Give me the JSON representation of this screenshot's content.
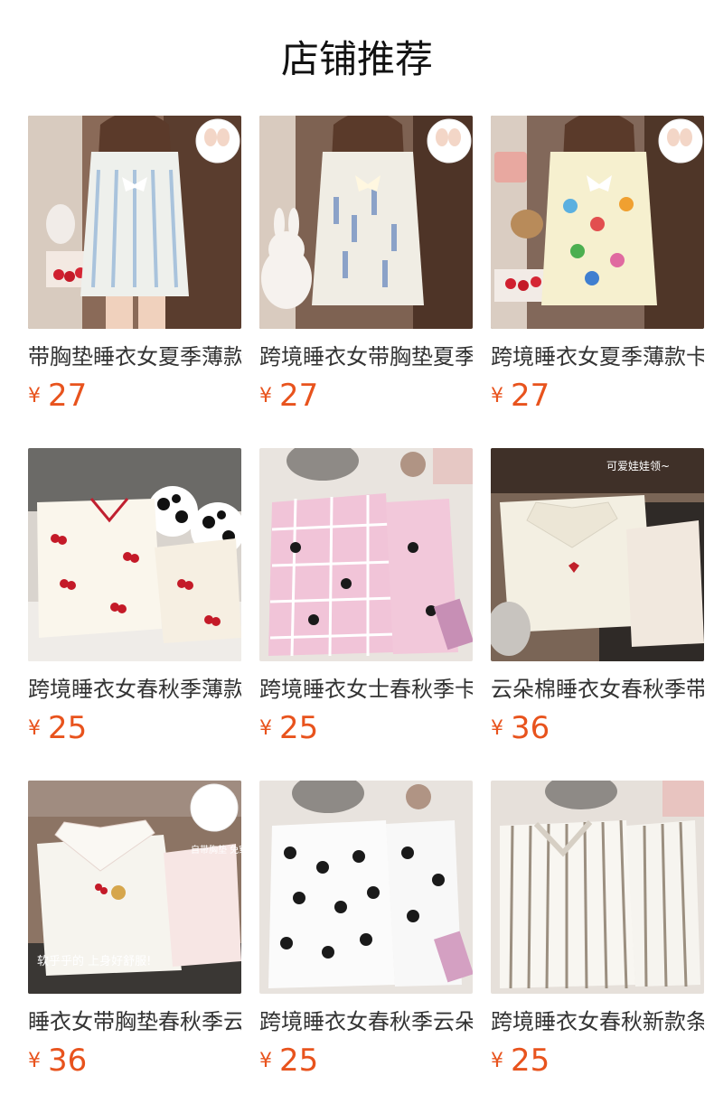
{
  "title": "店铺推荐",
  "currency_symbol": "¥",
  "products": [
    {
      "name": "带胸垫睡衣女夏季薄款",
      "price": "27",
      "badge": "自带胸垫",
      "image_desc": "woman-short-sleeve-floral-pajama"
    },
    {
      "name": "跨境睡衣女带胸垫夏季",
      "price": "27",
      "badge": "自带胸垫",
      "image_desc": "woman-white-floral-pajama-bunny"
    },
    {
      "name": "跨境睡衣女夏季薄款卡",
      "price": "27",
      "badge": "自带胸垫",
      "image_desc": "woman-yellow-cartoon-pajama"
    },
    {
      "name": "跨境睡衣女春秋季薄款",
      "price": "25",
      "badge": "",
      "image_desc": "cherry-print-pajama-set"
    },
    {
      "name": "跨境睡衣女士春秋季卡",
      "price": "25",
      "badge": "",
      "image_desc": "pink-plaid-cartoon-pajama-set"
    },
    {
      "name": "云朵棉睡衣女春秋季带",
      "price": "36",
      "badge": "可爱娃娃领~",
      "image_desc": "cream-doll-collar-pajama"
    },
    {
      "name": "睡衣女带胸垫春秋季云",
      "price": "36",
      "badge": "自带胸垫 免穿bra",
      "caption": "软乎乎的 上身好舒服!",
      "image_desc": "white-collar-bear-pajama"
    },
    {
      "name": "跨境睡衣女春秋季云朵",
      "price": "25",
      "badge": "",
      "image_desc": "white-black-cat-print-pajama"
    },
    {
      "name": "跨境睡衣女春秋新款条",
      "price": "25",
      "badge": "",
      "image_desc": "white-striped-pajama-set"
    }
  ],
  "colors": {
    "price": "#e8531d",
    "title": "#111111",
    "name": "#333333"
  }
}
